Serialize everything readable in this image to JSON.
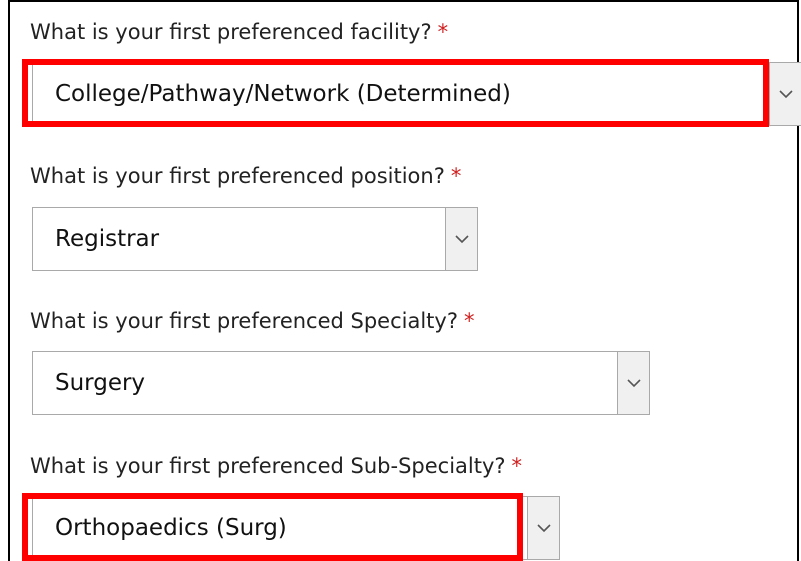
{
  "required_marker": "*",
  "fields": [
    {
      "question": "What is your first preferenced facility?",
      "selected": "College/Pathway/Network (Determined)",
      "highlighted": true
    },
    {
      "question": "What is your first preferenced position?",
      "selected": "Registrar",
      "highlighted": false
    },
    {
      "question": "What is your first preferenced Specialty?",
      "selected": "Surgery",
      "highlighted": false
    },
    {
      "question": "What is your first preferenced Sub-Specialty?",
      "selected": "Orthopaedics (Surg)",
      "highlighted": true
    }
  ],
  "colors": {
    "highlight": "#ff0000",
    "required": "#d12020"
  },
  "icons": {
    "dropdown": "chevron-down-icon"
  }
}
